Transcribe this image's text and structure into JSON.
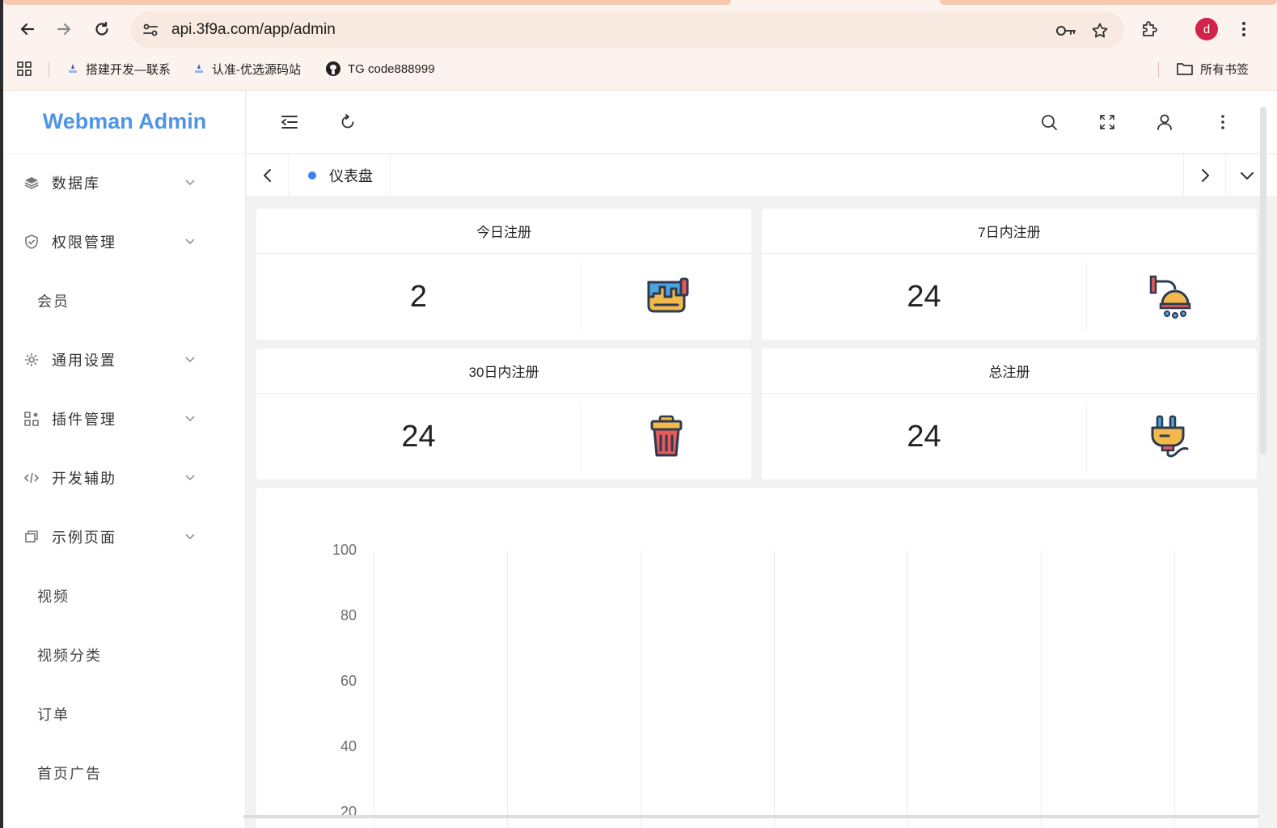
{
  "browser": {
    "url": "api.3f9a.com/app/admin",
    "profile_initial": "d",
    "bookmarks": [
      {
        "label": "搭建开发—联系"
      },
      {
        "label": "认准-优选源码站"
      },
      {
        "label": "TG code888999"
      }
    ],
    "all_bookmarks_label": "所有书签"
  },
  "app": {
    "brand": "Webman Admin",
    "sidebar": {
      "items": [
        {
          "label": "数据库",
          "icon": "layers-icon",
          "expandable": true
        },
        {
          "label": "权限管理",
          "icon": "shield-check-icon",
          "expandable": true
        },
        {
          "label": "会员",
          "expandable": false
        },
        {
          "label": "通用设置",
          "icon": "gear-icon",
          "expandable": true
        },
        {
          "label": "插件管理",
          "icon": "apps-icon",
          "expandable": true
        },
        {
          "label": "开发辅助",
          "icon": "code-icon",
          "expandable": true
        },
        {
          "label": "示例页面",
          "icon": "pages-icon",
          "expandable": true
        },
        {
          "label": "视频",
          "expandable": false
        },
        {
          "label": "视频分类",
          "expandable": false
        },
        {
          "label": "订单",
          "expandable": false
        },
        {
          "label": "首页广告",
          "expandable": false
        }
      ]
    },
    "tabs": [
      {
        "label": "仪表盘",
        "active": true
      }
    ],
    "stats": [
      {
        "title": "今日注册",
        "value": "2",
        "icon": "paint-bucket-icon"
      },
      {
        "title": "7日内注册",
        "value": "24",
        "icon": "shower-icon"
      },
      {
        "title": "30日内注册",
        "value": "24",
        "icon": "trash-bin-icon"
      },
      {
        "title": "总注册",
        "value": "24",
        "icon": "plug-icon"
      }
    ],
    "accent_color": "#4f94e6"
  },
  "chart_data": {
    "type": "bar",
    "y_ticks": [
      "100",
      "80",
      "60",
      "40",
      "20"
    ],
    "ylim": [
      0,
      100
    ],
    "grid": true
  }
}
